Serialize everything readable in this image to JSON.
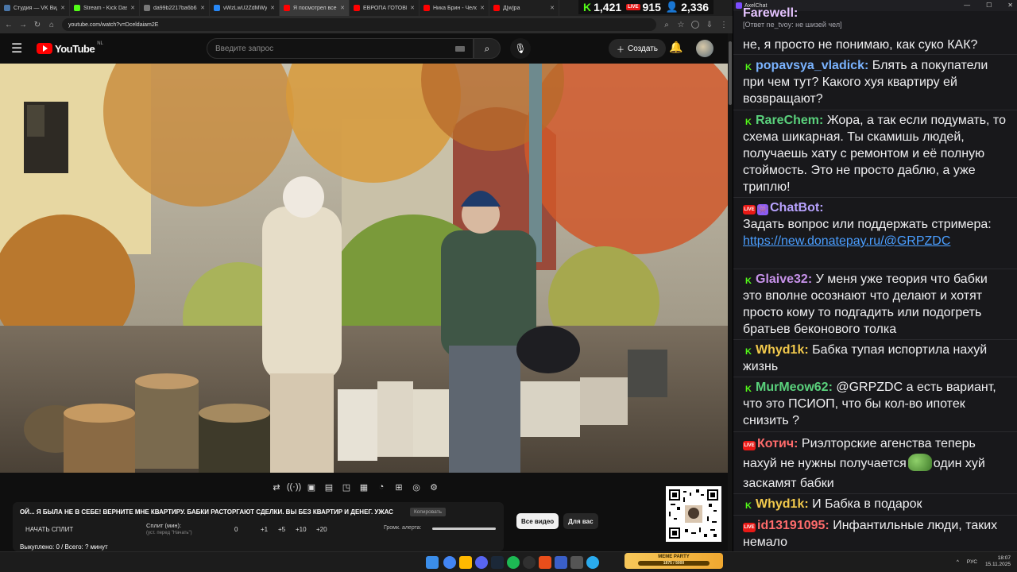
{
  "browser": {
    "tabs": [
      {
        "title": "Студия — VK Видео",
        "color": "#4a76a8"
      },
      {
        "title": "Stream - Kick Dashb",
        "color": "#53fc18"
      },
      {
        "title": "da99b2217ba6b63",
        "color": "#777777"
      },
      {
        "title": "vWzLwU2ZdMWyp",
        "color": "#2787f5"
      },
      {
        "title": "Я посмотрел все Х",
        "color": "#ff0000"
      },
      {
        "title": "ЕВРОПА ГОТОВИТ",
        "color": "#ff0000"
      },
      {
        "title": "Ника Брин - Челове",
        "color": "#ff0000"
      },
      {
        "title": "Д[w]ра",
        "color": "#ff0000"
      }
    ],
    "url": "youtube.com/watch?v=Dceldaiam2E"
  },
  "stats": {
    "kick": "1,421",
    "vk": "915",
    "viewers": "2,336"
  },
  "youtube": {
    "logo": "YouTube",
    "region": "NL",
    "search_placeholder": "Введите запрос",
    "create_label": "Создать"
  },
  "panel": {
    "title": "ОЙ... Я БЫЛА НЕ В СЕБЕ! ВЕРНИТЕ МНЕ КВАРТИРУ. БАБКИ РАСТОРГАЮТ СДЕЛКИ. ВЫ БЕЗ КВАРТИР И ДЕНЕГ. УЖАС",
    "copy_label": "Копировать",
    "start_label": "НАЧАТЬ СПЛИТ",
    "split_label": "Сплит (мин):",
    "split_hint": "(уст. перед \"Начать\")",
    "split_value": "0",
    "steps": [
      "+1",
      "+5",
      "+10",
      "+20"
    ],
    "volume_label": "Громк. алерта:",
    "volume_level": 1.0,
    "status": "Выкуплено: 0 / Всего: ? минут"
  },
  "chips": [
    {
      "label": "Все видео",
      "active": true
    },
    {
      "label": "Для вас",
      "active": false
    }
  ],
  "meme": {
    "title": "MEME PARTY",
    "progress": "1875 / 5000"
  },
  "tray": {
    "lang": "РУС",
    "time": "18:07",
    "date": "15.11.2025"
  },
  "chat": {
    "app_title": "AxelChat",
    "messages": [
      {
        "user": "Farewell:",
        "reply": "[Ответ ne_tvoy: не шизей чел]",
        "text": "не, я просто не понимаю, как суко КАК?"
      },
      {
        "user": "popavsya_vladick:",
        "platform": "kick",
        "color": "#7ab3ff",
        "text": "Блять а покупатели при чем тут? Какого хуя квартиру ей возвращают?"
      },
      {
        "user": "RareChem:",
        "platform": "kick",
        "color": "#5ad17c",
        "text": "Жора, а так если подумать, то схема шикарная. Ты скамишь людей, получаешь хату с ремонтом и её полную стоймость. Это не просто даблю, а уже триплю!"
      },
      {
        "user": "ChatBot:",
        "platform": "vk",
        "color": "#b8a3ff",
        "text": "Задать вопрос или поддержать стримера:",
        "link": "https://new.donatepay.ru/@GRPZDC"
      },
      {
        "user": "Glaive32:",
        "platform": "kick",
        "color": "#c792ea",
        "text": "У меня уже теория что бабки это вполне осознают что делают и хотят просто кому то подгадить или подогреть братьев беконового толка"
      },
      {
        "user": "Whyd1k:",
        "platform": "kick",
        "color": "#f2c94c",
        "text": "Бабка тупая испортила нахуй жизнь"
      },
      {
        "user": "MurMeow62:",
        "platform": "kick",
        "color": "#5ad17c",
        "text": "@GRPZDC а есть вариант, что это ПСИОП, что бы кол-во ипотек снизить ?"
      },
      {
        "user": "Котич:",
        "platform": "vk",
        "color": "#ff6b6b",
        "text_a": "Риэлторские агенства теперь нахуй не нужны получается",
        "emote": "pepe-emote",
        "text_b": "один хуй заскамят бабки"
      },
      {
        "user": "Whyd1k:",
        "platform": "kick",
        "color": "#f2c94c",
        "text": "И Бабка в подарок"
      },
      {
        "user": "id13191095:",
        "platform": "vk",
        "color": "#ff6b6b",
        "text": "Инфантильные люди, таких немало"
      }
    ]
  }
}
